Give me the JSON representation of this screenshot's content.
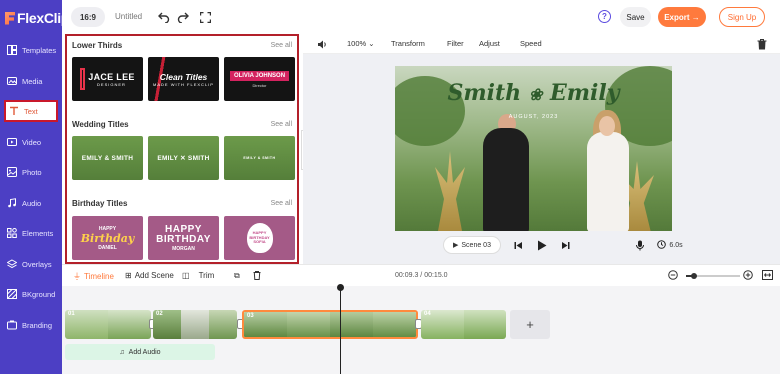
{
  "app": {
    "logo_text": "FlexClip"
  },
  "sidebar": {
    "items": [
      {
        "label": "Templates"
      },
      {
        "label": "Media"
      },
      {
        "label": "Text"
      },
      {
        "label": "Video"
      },
      {
        "label": "Photo"
      },
      {
        "label": "Audio"
      },
      {
        "label": "Elements"
      },
      {
        "label": "Overlays"
      },
      {
        "label": "BKground"
      },
      {
        "label": "Branding"
      }
    ]
  },
  "topbar": {
    "aspect_ratio": "16:9",
    "project_name": "Untitled",
    "help_label": "?",
    "save_label": "Save",
    "export_label": "Export →",
    "signup_label": "Sign Up"
  },
  "panel": {
    "sections": [
      {
        "title": "Lower Thirds",
        "see_all": "See all"
      },
      {
        "title": "Wedding Titles",
        "see_all": "See all"
      },
      {
        "title": "Birthday Titles",
        "see_all": "See all"
      }
    ],
    "lower_thirds": {
      "t1_name": "JACE LEE",
      "t1_sub": "DESIGNER",
      "t2_name": "Clean Titles",
      "t2_sub": "MADE WITH FLEXCLIP",
      "t3_name": "OLIVIA JOHNSON",
      "t3_sub": "Director"
    },
    "wedding": {
      "t1": "EMILY & SMITH",
      "t2": "EMILY ✕ SMITH",
      "t3": "EMILY & SMITH"
    },
    "birthday": {
      "t1_top": "HAPPY",
      "t1_script": "Birthday",
      "t1_name": "DANIEL",
      "t2_big": "HAPPY BIRTHDAY",
      "t2_name": "MORGAN",
      "t3_text": "HAPPY BIRTHDAY SOFIA"
    }
  },
  "edit_toolbar": {
    "zoom": "100%",
    "transform": "Transform",
    "filter": "Filter",
    "adjust": "Adjust",
    "speed": "Speed"
  },
  "preview": {
    "title_left": "Smith",
    "title_right": "Emily",
    "subtitle": "AUGUST, 2023",
    "scene_label": "Scene 03",
    "duration": "6.0s"
  },
  "timeline_toolbar": {
    "timeline_label": "Timeline",
    "add_scene_label": "Add Scene",
    "trim_label": "Trim",
    "timecode": "00:09.3 / 00:15.0"
  },
  "timeline": {
    "clips": [
      {
        "number": "01"
      },
      {
        "number": "02"
      },
      {
        "number": "03"
      },
      {
        "number": "04"
      }
    ],
    "add_clip_label": "+",
    "add_audio_label": "Add Audio"
  },
  "colors": {
    "sidebar": "#4c3fc4",
    "accent": "#ff7a3d",
    "highlight_border": "#b3202a"
  }
}
